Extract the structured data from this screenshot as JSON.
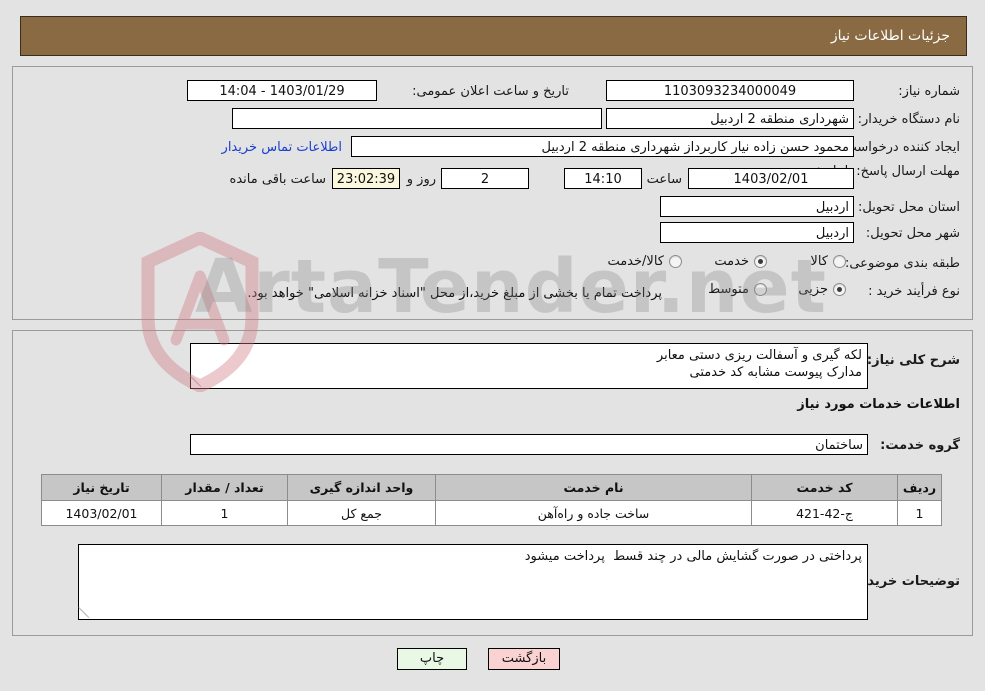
{
  "header": {
    "title": "جزئیات اطلاعات نیاز"
  },
  "form": {
    "need_number_label": "شماره نیاز:",
    "need_number_value": "1103093234000049",
    "announce_datetime_label": "تاریخ و ساعت اعلان عمومی:",
    "announce_datetime_value": "1403/01/29 - 14:04",
    "buyer_org_label": "نام دستگاه خریدار:",
    "buyer_org_value": "شهرداری منطقه 2 اردبیل",
    "buyer_org_empty_value": "",
    "creator_label": "ایجاد کننده درخواست:",
    "creator_value": "محمود حسن زاده نیار کاربرداز شهرداری منطقه 2 اردبیل",
    "buyer_contact_link": "اطلاعات تماس خریدار",
    "deadline_label": "مهلت ارسال پاسخ: تا تاریخ:",
    "deadline_date_value": "1403/02/01",
    "deadline_hour_label": "ساعت",
    "deadline_hour_value": "14:10",
    "remaining_days_value": "2",
    "remaining_days_label": "روز و",
    "remaining_time_value": "23:02:39",
    "remaining_time_label": "ساعت باقی مانده",
    "province_label": "استان محل تحویل:",
    "province_value": "اردبیل",
    "city_label": "شهر محل تحویل:",
    "city_value": "اردبیل",
    "category_label": "طبقه بندی موضوعی:",
    "category_options": [
      {
        "label": "کالا",
        "selected": false
      },
      {
        "label": "خدمت",
        "selected": true
      },
      {
        "label": "کالا/خدمت",
        "selected": false
      }
    ],
    "process_label": "نوع فرأیند خرید :",
    "process_options": [
      {
        "label": "جزیی",
        "selected": true
      },
      {
        "label": "متوسط",
        "selected": false
      }
    ],
    "payment_note": "پرداخت تمام یا بخشی از مبلغ خرید،از محل \"اسناد خزانه اسلامی\" خواهد بود."
  },
  "description": {
    "general_label": "شرح کلی نیاز:",
    "general_value": "لکه گیری و آسفالت ریزی دستی معابر\nمدارک پیوست مشابه کد خدمتی",
    "services_section_title": "اطلاعات خدمات مورد نیاز",
    "service_group_label": "گروه خدمت:",
    "service_group_value": "ساختمان"
  },
  "table": {
    "headers": [
      "ردیف",
      "کد خدمت",
      "نام خدمت",
      "واحد اندازه گیری",
      "تعداد / مقدار",
      "تاریخ نیاز"
    ],
    "rows": [
      [
        "1",
        "ج-42-421",
        "ساخت جاده و راه‌آهن",
        "جمع کل",
        "1",
        "1403/02/01"
      ]
    ]
  },
  "buyer_notes": {
    "label": "توضیحات خریدار:",
    "value": "پرداختی در صورت گشایش مالی در چند قسط  پرداخت میشود"
  },
  "footer": {
    "print_label": "چاپ",
    "back_label": "بازگشت"
  },
  "watermark": {
    "text": "ArtaTender.net"
  },
  "colors": {
    "header_bg": "#8a6a42",
    "page_bg": "#e3e3e3",
    "link": "#1a3fd0",
    "timer_bg": "#fbf8dd",
    "table_header_bg": "#c6c6c6",
    "print_btn_bg": "#e9f7e5",
    "back_btn_bg": "#fbd2d2"
  }
}
